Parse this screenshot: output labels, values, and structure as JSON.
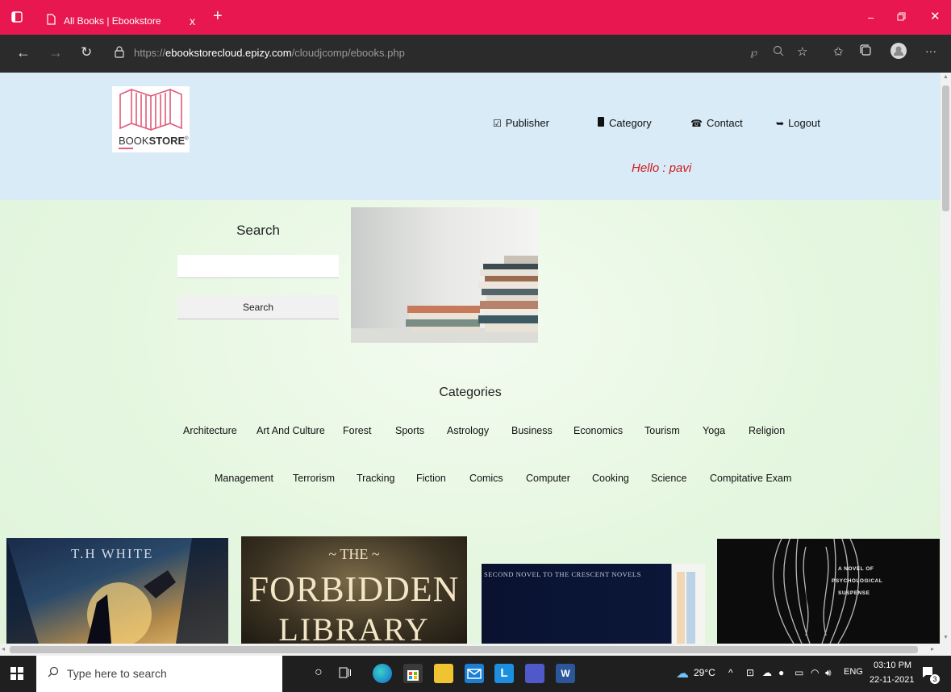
{
  "browser": {
    "tab_title": "All Books | Ebookstore",
    "close_label": "x",
    "new_tab_label": "+",
    "url_prefix": "https://",
    "url_domain": "ebookstorecloud.epizy.com",
    "url_path": "/cloudjcomp/ebooks.php"
  },
  "site": {
    "logo_text_light": "BOOK",
    "logo_text_bold": "STORE",
    "nav": {
      "publisher": "Publisher",
      "category": "Category",
      "contact": "Contact",
      "logout": "Logout"
    },
    "greeting": "Hello : pavi"
  },
  "search": {
    "title": "Search",
    "input_value": "",
    "button_label": "Search"
  },
  "categories": {
    "title": "Categories",
    "row1": [
      "Architecture",
      "Art And Culture",
      "Forest",
      "Sports",
      "Astrology",
      "Business",
      "Economics",
      "Tourism",
      "Yoga",
      "Religion"
    ],
    "row2": [
      "Management",
      "Terrorism",
      "Tracking",
      "Fiction",
      "Comics",
      "Computer",
      "Cooking",
      "Science",
      "Compitative Exam"
    ]
  },
  "books": {
    "b1_author": "T.H WHITE",
    "b2_the": "THE",
    "b2_title1": "FORBIDDEN",
    "b2_title2": "LIBRARY",
    "b3_tagline": "SECOND NOVEL TO THE CRESCENT NOVELS",
    "b4_line1": "A NOVEL OF",
    "b4_line2": "PSYCHOLOGICAL",
    "b4_line3": "SUSPENSE"
  },
  "taskbar": {
    "search_placeholder": "Type here to search",
    "temperature": "29°C",
    "language": "ENG",
    "time": "03:10 PM",
    "date": "22-11-2021",
    "notification_count": "3"
  },
  "colors": {
    "tab_bar": "#e8174f",
    "header_bg": "#d9ebf6",
    "greeting": "#d0181f",
    "logo_pink": "#e05a7a"
  }
}
